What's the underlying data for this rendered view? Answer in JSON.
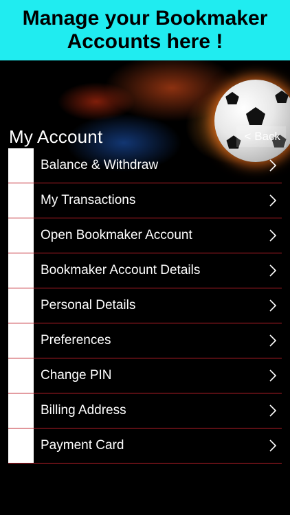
{
  "banner": {
    "line1": "Manage your Bookmaker",
    "line2": "Accounts here !"
  },
  "header": {
    "title": "My Account",
    "back_label": "< Back"
  },
  "menu": {
    "items": [
      {
        "label": "Balance & Withdraw"
      },
      {
        "label": "My Transactions"
      },
      {
        "label": "Open Bookmaker Account"
      },
      {
        "label": "Bookmaker Account Details"
      },
      {
        "label": "Personal Details"
      },
      {
        "label": "Preferences"
      },
      {
        "label": "Change PIN"
      },
      {
        "label": "Billing Address"
      },
      {
        "label": "Payment Card"
      }
    ],
    "chevron_icon": "chevron-right-icon"
  },
  "colors": {
    "banner_bg": "#20ecf0",
    "background": "#000000",
    "divider": "#c0202a",
    "text": "#ffffff"
  }
}
